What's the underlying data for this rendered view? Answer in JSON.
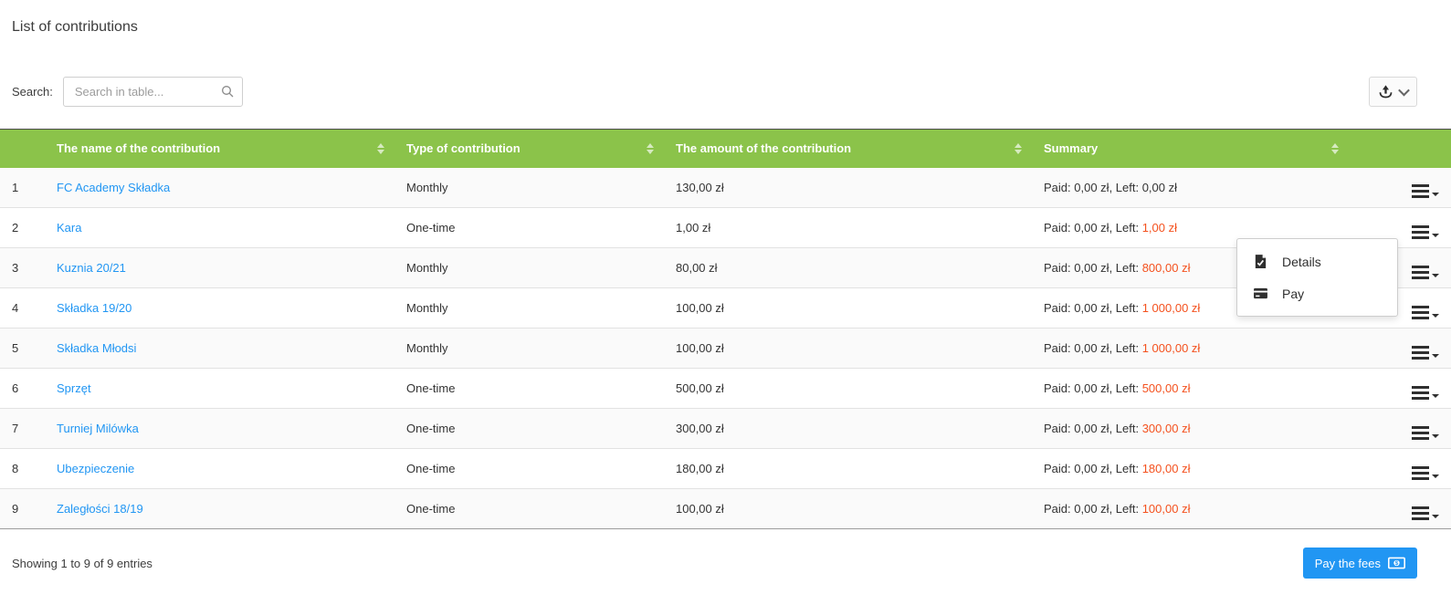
{
  "palette": {
    "header_green": "#8bc34a",
    "link_blue": "#2196f3",
    "alert_red": "#f4511e",
    "button_blue": "#2196f3"
  },
  "page": {
    "title": "List of contributions"
  },
  "search": {
    "label": "Search:",
    "placeholder": "Search in table..."
  },
  "table": {
    "headers": [
      "The name of the contribution",
      "Type of contribution",
      "The amount of the contribution",
      "Summary"
    ],
    "summary_paid_label": "Paid: ",
    "summary_left_label": ", Left: ",
    "rows": [
      {
        "index": "1",
        "name": "FC Academy Składka",
        "type": "Monthly",
        "amount": "130,00 zł",
        "paid": "0,00 zł",
        "left": "0,00 zł",
        "left_red": false
      },
      {
        "index": "2",
        "name": "Kara",
        "type": "One-time",
        "amount": "1,00 zł",
        "paid": "0,00 zł",
        "left": "1,00 zł",
        "left_red": true
      },
      {
        "index": "3",
        "name": "Kuznia 20/21",
        "type": "Monthly",
        "amount": "80,00 zł",
        "paid": "0,00 zł",
        "left": "800,00 zł",
        "left_red": true
      },
      {
        "index": "4",
        "name": "Składka 19/20",
        "type": "Monthly",
        "amount": "100,00 zł",
        "paid": "0,00 zł",
        "left": "1 000,00 zł",
        "left_red": true
      },
      {
        "index": "5",
        "name": "Składka Młodsi",
        "type": "Monthly",
        "amount": "100,00 zł",
        "paid": "0,00 zł",
        "left": "1 000,00 zł",
        "left_red": true
      },
      {
        "index": "6",
        "name": "Sprzęt",
        "type": "One-time",
        "amount": "500,00 zł",
        "paid": "0,00 zł",
        "left": "500,00 zł",
        "left_red": true
      },
      {
        "index": "7",
        "name": "Turniej Milówka",
        "type": "One-time",
        "amount": "300,00 zł",
        "paid": "0,00 zł",
        "left": "300,00 zł",
        "left_red": true
      },
      {
        "index": "8",
        "name": "Ubezpieczenie",
        "type": "One-time",
        "amount": "180,00 zł",
        "paid": "0,00 zł",
        "left": "180,00 zł",
        "left_red": true
      },
      {
        "index": "9",
        "name": "Zaległości 18/19",
        "type": "One-time",
        "amount": "100,00 zł",
        "paid": "0,00 zł",
        "left": "100,00 zł",
        "left_red": true
      }
    ]
  },
  "menu": {
    "items": [
      {
        "label": "Details",
        "icon": "document-check-icon"
      },
      {
        "label": "Pay",
        "icon": "credit-card-icon"
      }
    ]
  },
  "footer": {
    "entries_info": "Showing 1 to 9 of 9 entries",
    "pay_button_label": "Pay the fees"
  }
}
